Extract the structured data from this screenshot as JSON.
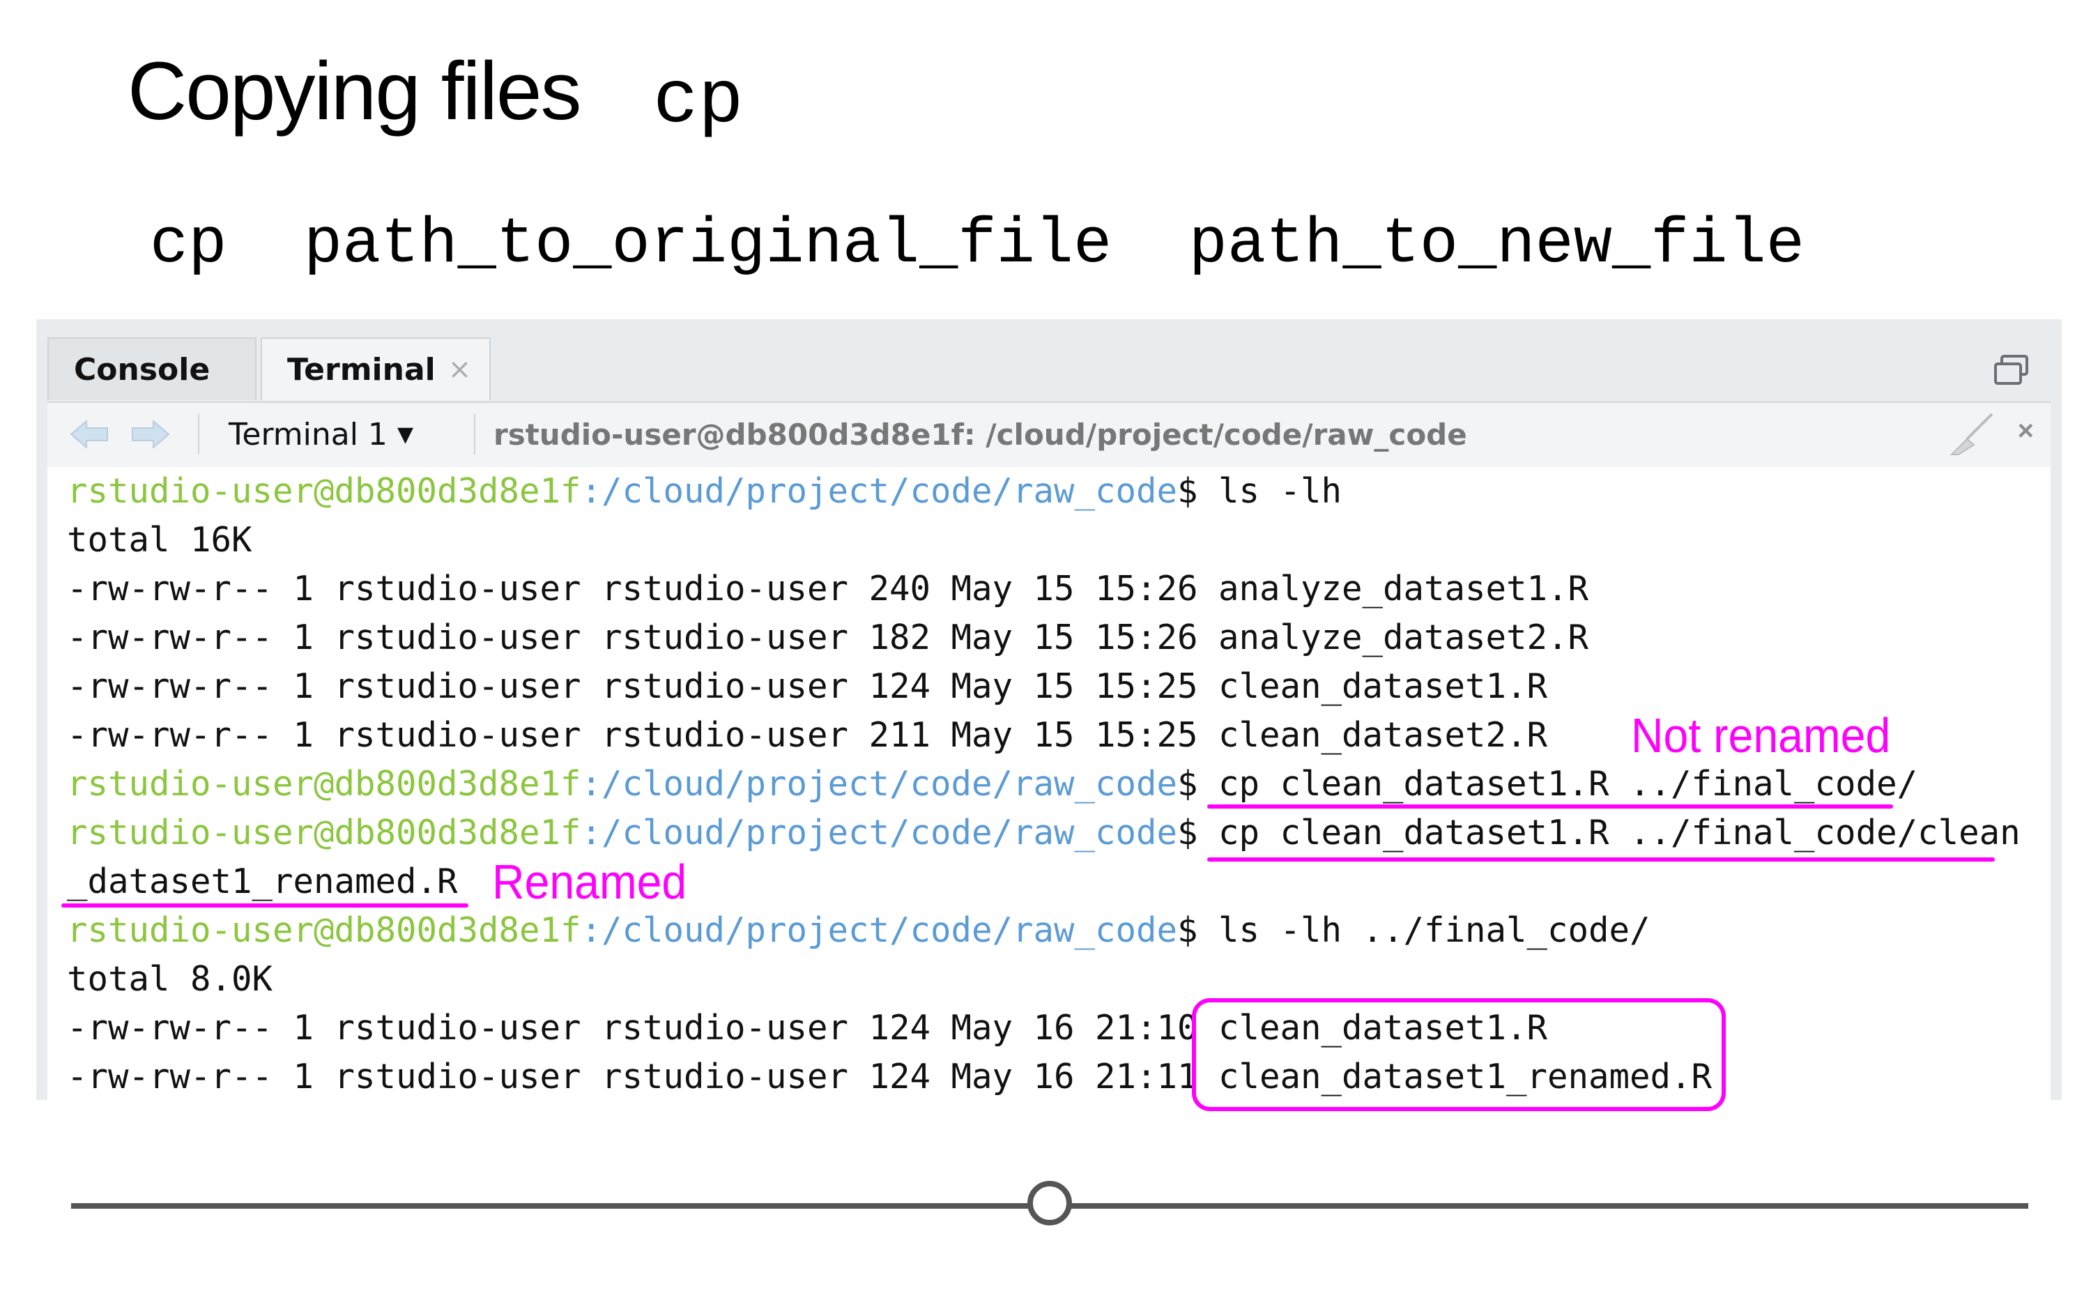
{
  "slide": {
    "title": "Copying files",
    "title_command": "cp",
    "syntax": "cp  path_to_original_file  path_to_new_file"
  },
  "pane": {
    "tabs": [
      {
        "label": "Console"
      },
      {
        "label": "Terminal",
        "close": "×"
      }
    ],
    "terminal_selector": "Terminal 1",
    "terminal_path": "rstudio-user@db800d3d8e1f: /cloud/project/code/raw_code",
    "toolbar_close": "×"
  },
  "prompt": {
    "user": "rstudio-user@db800d3d8e1f",
    "path": ":/cloud/project/code/raw_code",
    "symbol": "$"
  },
  "terminal": {
    "cmd1": " ls -lh",
    "out1": "total 16K",
    "rows1": [
      "-rw-rw-r-- 1 rstudio-user rstudio-user 240 May 15 15:26 analyze_dataset1.R",
      "-rw-rw-r-- 1 rstudio-user rstudio-user 182 May 15 15:26 analyze_dataset2.R",
      "-rw-rw-r-- 1 rstudio-user rstudio-user 124 May 15 15:25 clean_dataset1.R",
      "-rw-rw-r-- 1 rstudio-user rstudio-user 211 May 15 15:25 clean_dataset2.R"
    ],
    "cmd2": " cp clean_dataset1.R ../final_code/",
    "cmd3": " cp clean_dataset1.R ../final_code/clean",
    "cmd3_wrap": "_dataset1_renamed.R",
    "cmd4": " ls -lh ../final_code/",
    "out4": "total 8.0K",
    "rows2": [
      "-rw-rw-r-- 1 rstudio-user rstudio-user 124 May 16 21:10 clean_dataset1.R",
      "-rw-rw-r-- 1 rstudio-user rstudio-user 124 May 16 21:11 clean_dataset1_renamed.R"
    ]
  },
  "annotations": {
    "not_renamed": "Not renamed",
    "renamed": "Renamed"
  },
  "progress": {
    "position": 0.5
  },
  "colors": {
    "annotation": "#ff00ff",
    "prompt_user": "#8cc63f",
    "prompt_path": "#5b9bd5"
  }
}
